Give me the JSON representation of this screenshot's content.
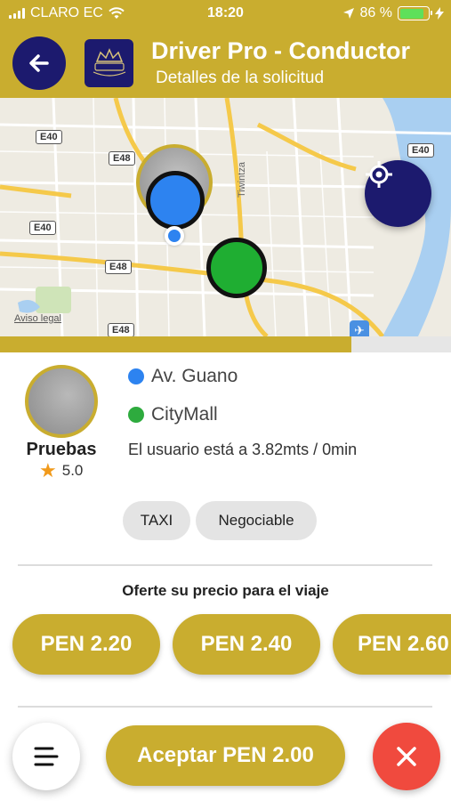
{
  "status_bar": {
    "carrier": "CLARO EC",
    "time": "18:20",
    "battery": "86 %"
  },
  "header": {
    "title": "Driver Pro - Conductor",
    "subtitle": "Detalles de la solicitud",
    "logo_text": "ΘΞΞ"
  },
  "map": {
    "road_labels": [
      "E40",
      "E48",
      "E40",
      "E48",
      "E48",
      "E40"
    ],
    "street_name": "Tiwintza",
    "legal_link": "Aviso legal"
  },
  "progress": {
    "value_percent": 78
  },
  "client": {
    "name": "Pruebas",
    "rating": "5.0",
    "pickup": "Av. Guano",
    "destination": "CityMall",
    "distance_text": "El usuario está a 3.82mts / 0min"
  },
  "tags": [
    "TAXI",
    "Negociable"
  ],
  "offer": {
    "title": "Oferte su precio para el viaje",
    "prices": [
      "PEN 2.20",
      "PEN 2.40",
      "PEN 2.60"
    ]
  },
  "actions": {
    "accept_label": "Aceptar PEN 2.00"
  },
  "colors": {
    "brand_gold": "#c9ad2f",
    "navy": "#1c1a6e",
    "cancel_red": "#f04a3e",
    "pickup_blue": "#2d83f0",
    "destination_green": "#2eab3e"
  },
  "icons": {
    "back": "arrow-left-icon",
    "locate": "crosshair-icon",
    "menu": "menu-lines-icon",
    "cancel": "close-icon",
    "rating": "star-icon"
  }
}
